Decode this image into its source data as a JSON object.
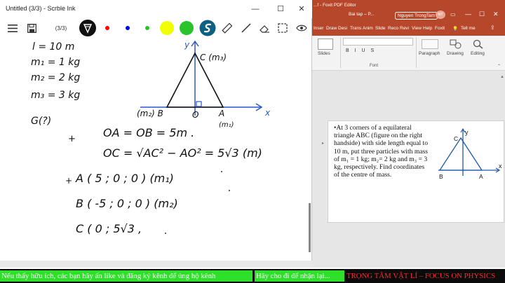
{
  "ink": {
    "title": "Untitled (3/3) - Scrble Ink",
    "page": "(3/3)",
    "controls": {
      "minimize": "—",
      "maximize": "☐",
      "close": "✕"
    },
    "colors": [
      "#ff0000",
      "#0000ff",
      "#22c81e",
      "#f2ff00",
      "#29c42c"
    ],
    "handwriting": {
      "givens": [
        "l = 10 m",
        "m₁ = 1 kg",
        "m₂ = 2 kg",
        "m₃ = 3 kg",
        "G(?)"
      ],
      "axis_y": "y",
      "axis_x": "x",
      "label_C": "C (m₃)",
      "label_B": "(m₂) B",
      "label_O": "O",
      "label_A": "A",
      "label_A_mass": "(m₁)",
      "eq1": "OA = OB = 5m .",
      "eq2": "OC = √AC² − AO² = 5√3   (m)",
      "eqA": "A ( 5 ; 0 ; 0 )   (m₁)",
      "eqB": "B ( -5 ; 0 ; 0 )   (m₂)",
      "eqC": "C ( 0 ; 5√3 ,",
      "plus1": "+",
      "plus2": "+"
    }
  },
  "foxit": {
    "title": "...f - Foxit PDF Editor",
    "doc_tab": "Bai tap – P...",
    "user": "Nguyen TrongTam",
    "user_initials": "NT",
    "ribbon_tabs": [
      "Inser",
      "Draw",
      "Desi",
      "Trans",
      "Anim",
      "Slide",
      "Reco",
      "Revi",
      "View",
      "Help",
      "Foxit"
    ],
    "tell_me": "Tell me",
    "groups": {
      "slides": "Slides",
      "paragraph": "Paragraph",
      "drawing": "Drawing",
      "editing": "Editing",
      "font": "Font"
    },
    "slide": {
      "text": "•At 3 corners of a equilateral triangle ABC (figure on the right handside) with side length equal to 10 m, put three particles with mass of m₁ = 1 kg; m₂= 2 kg and m₃ = 3 kg, respectively. Find coordinates of the centre of mass.",
      "fig_y": "y",
      "fig_x": "x",
      "fig_C": "C",
      "fig_B": "B",
      "fig_A": "A"
    }
  },
  "banner": {
    "part1": "Nếu thấy hữu ích, các bạn hãy ấn like và đăng ký kênh để ủng hộ kênh",
    "part2": "Hãy cho đi để nhận lại...",
    "part3": "TRỌNG TÂM VẬT LÍ – FOCUS ON PHYSICS"
  }
}
